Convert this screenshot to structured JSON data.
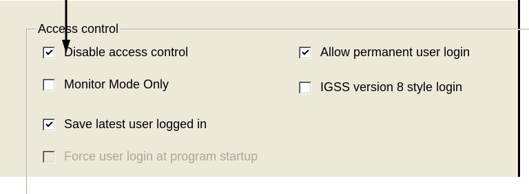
{
  "group": {
    "title": "Access control"
  },
  "options": {
    "disable_access_control": {
      "label": "Disable access control",
      "checked": true,
      "enabled": true
    },
    "monitor_mode_only": {
      "label": "Monitor Mode Only",
      "checked": false,
      "enabled": true
    },
    "save_latest_user": {
      "label": "Save latest user logged in",
      "checked": true,
      "enabled": true
    },
    "force_user_login": {
      "label": "Force user login at program startup",
      "checked": false,
      "enabled": false
    },
    "allow_permanent_login": {
      "label": "Allow permanent user login",
      "checked": true,
      "enabled": true
    },
    "igss_v8_style_login": {
      "label": "IGSS version 8 style login",
      "checked": false,
      "enabled": true
    }
  },
  "colors": {
    "face": "#ece9d8",
    "disabled_text": "#aca899",
    "annotation_arrow": "#000000"
  },
  "icons": {
    "annotation": "arrow-down-icon",
    "check": "check-icon"
  }
}
